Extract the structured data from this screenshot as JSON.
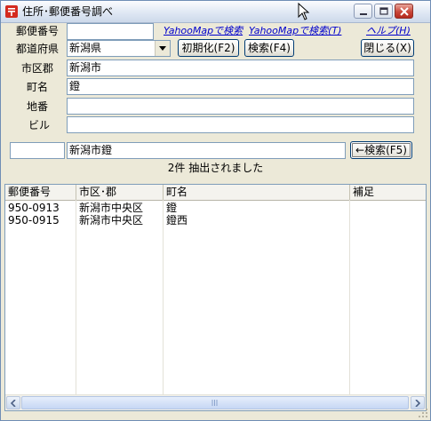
{
  "window": {
    "title": "住所･郵便番号調べ"
  },
  "form": {
    "postal_label": "郵便番号",
    "postal_value": "",
    "pref_label": "都道府県",
    "pref_value": "新潟県",
    "city_label": "市区郡",
    "city_value": "新潟市",
    "town_label": "町名",
    "town_value": "鐙",
    "block_label": "地番",
    "block_value": "",
    "building_label": "ビル",
    "building_value": ""
  },
  "links": {
    "yahoo_map": "YahooMapで検索",
    "yahoo_search": "YahooMapで検索(T)",
    "help": "ヘルプ(H)"
  },
  "buttons": {
    "init": "初期化(F2)",
    "search": "検索(F4)",
    "close": "閉じる(X)",
    "reverse_search": "←検索(F5)"
  },
  "search_bar": {
    "left_value": "",
    "query_value": "新潟市鐙"
  },
  "status": {
    "text": "2件 抽出されました"
  },
  "results": {
    "headers": [
      "郵便番号",
      "市区･郡",
      "町名",
      "補足"
    ],
    "rows": [
      [
        "950-0913",
        "新潟市中央区",
        "鐙",
        ""
      ],
      [
        "950-0915",
        "新潟市中央区",
        "鐙西",
        ""
      ]
    ]
  },
  "colors": {
    "link": "#0000cc",
    "close_button": "#c9473a",
    "window_bg": "#ece9d8"
  }
}
